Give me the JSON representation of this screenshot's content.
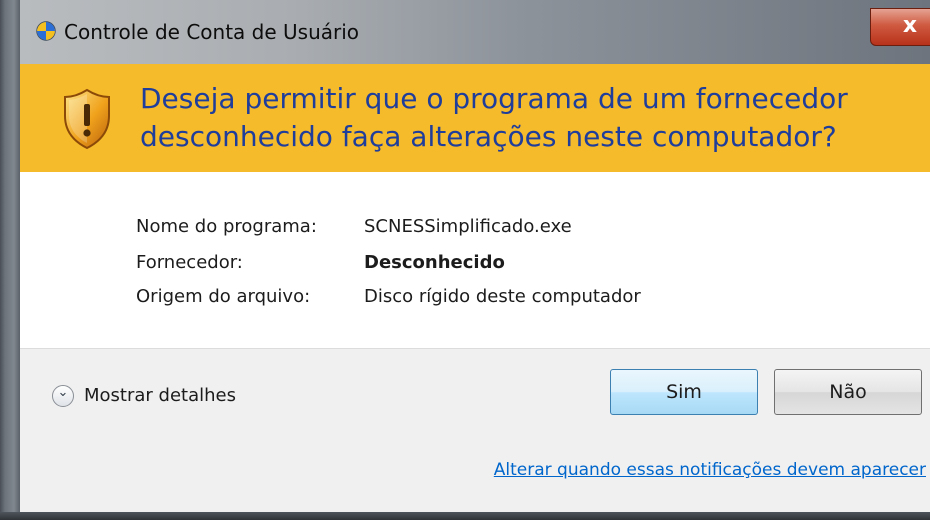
{
  "window": {
    "title": "Controle de Conta de Usuário",
    "close_label": "x",
    "icons": {
      "app": "uac-shield-icon",
      "warning": "warning-shield-icon",
      "close": "close-icon",
      "details": "chevron-down-icon"
    }
  },
  "banner": {
    "line1": "Deseja permitir que o programa de um fornecedor",
    "line2": "desconhecido faça alterações neste computador?"
  },
  "info": {
    "program_label": "Nome do programa:",
    "program_value": "SCNESSimplificado.exe",
    "publisher_label": "Fornecedor:",
    "publisher_value": "Desconhecido",
    "origin_label": "Origem do arquivo:",
    "origin_value": "Disco rígido deste computador"
  },
  "actions": {
    "details_label": "Mostrar detalhes",
    "yes_label": "Sim",
    "no_label": "Não"
  },
  "footer": {
    "link_label": "Alterar quando essas notificações devem aparecer"
  },
  "colors": {
    "banner_bg": "#f6bb2b",
    "banner_text": "#1f3d9b",
    "link": "#0066cc",
    "close_button": "#c8452c",
    "default_button": "#bee6fd"
  }
}
